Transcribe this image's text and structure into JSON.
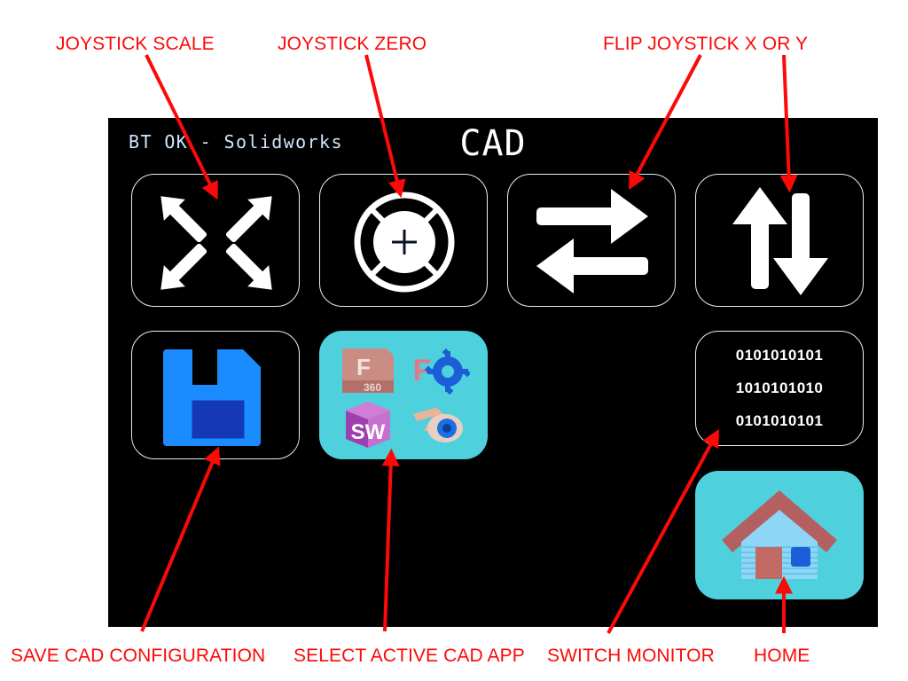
{
  "device": {
    "status_text": "BT OK - Solidworks",
    "title": "CAD",
    "screen_bg": "#000000",
    "outline_color": "#dff0ff",
    "accent_cyan": "#4fd0dd",
    "save_blue": "#1a8cff"
  },
  "tiles": [
    {
      "id": "joystick-scale",
      "icon": "four-diagonal-arrows-icon",
      "style": "outline"
    },
    {
      "id": "joystick-zero",
      "icon": "crosshair-target-icon",
      "style": "outline"
    },
    {
      "id": "flip-joystick-x",
      "icon": "horizontal-swap-arrows-icon",
      "style": "outline"
    },
    {
      "id": "flip-joystick-y",
      "icon": "vertical-swap-arrows-icon",
      "style": "outline"
    },
    {
      "id": "save-cad-configuration",
      "icon": "floppy-disk-icon",
      "style": "outline"
    },
    {
      "id": "select-active-cad-app",
      "icon": "cad-apps-icon",
      "style": "filled"
    },
    {
      "id": "switch-monitor",
      "icon": "binary-stream-icon",
      "style": "outline"
    },
    {
      "id": "home",
      "icon": "house-icon",
      "style": "filled"
    }
  ],
  "binary_rows": [
    "0101010101",
    "1010101010",
    "0101010101"
  ],
  "cad_apps": [
    {
      "id": "fusion360",
      "label": "F",
      "sublabel": "360"
    },
    {
      "id": "freecad",
      "label": "F",
      "sublabel": ""
    },
    {
      "id": "solidworks",
      "label": "SW",
      "sublabel": ""
    },
    {
      "id": "blender",
      "label": "",
      "sublabel": ""
    }
  ],
  "callouts": {
    "color": "#fb0a08",
    "items": [
      {
        "id": "joystick-scale",
        "label": "JOYSTICK SCALE"
      },
      {
        "id": "joystick-zero",
        "label": "JOYSTICK ZERO"
      },
      {
        "id": "flip-joystick-x-or-y",
        "label": "FLIP JOYSTICK X OR Y"
      },
      {
        "id": "save-cad-configuration",
        "label": "SAVE CAD CONFIGURATION"
      },
      {
        "id": "select-active-cad-app",
        "label": "SELECT ACTIVE CAD APP"
      },
      {
        "id": "switch-monitor",
        "label": "SWITCH MONITOR"
      },
      {
        "id": "home",
        "label": "HOME"
      }
    ]
  }
}
